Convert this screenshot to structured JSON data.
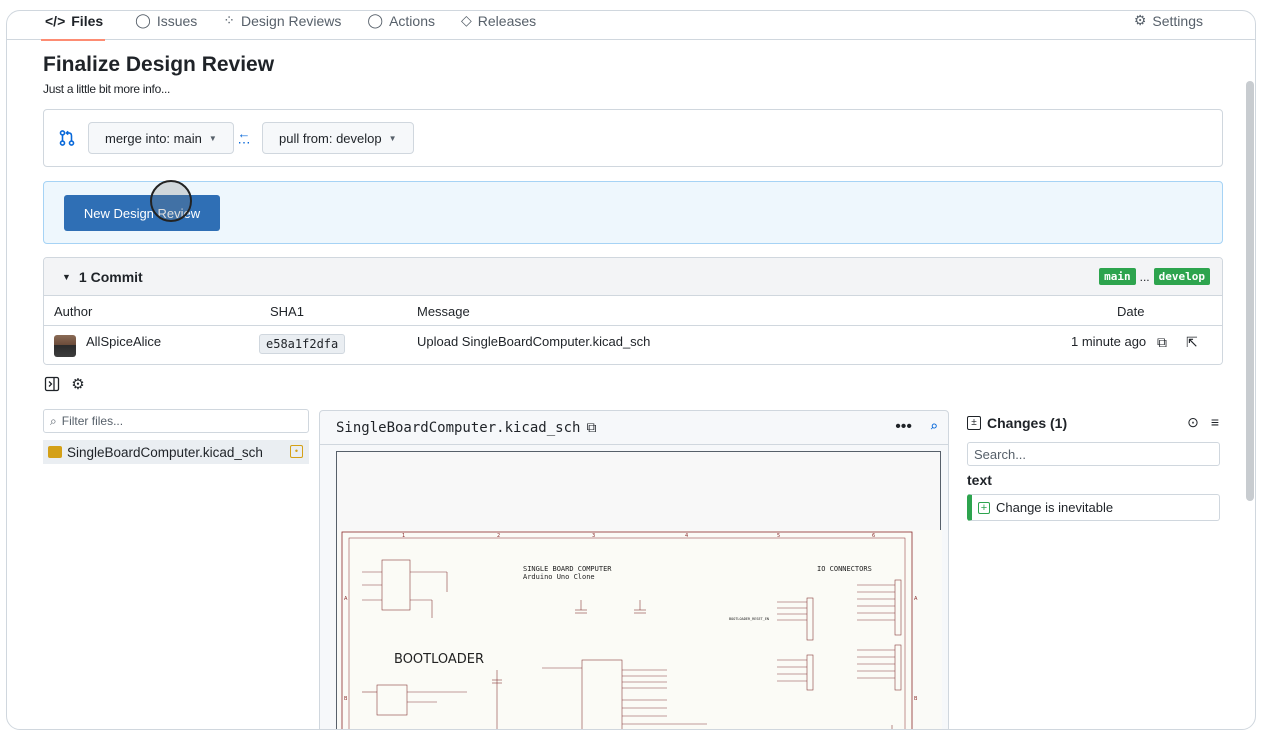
{
  "nav": {
    "tabs": [
      {
        "label": "Files",
        "icon": "code-icon"
      },
      {
        "label": "Issues",
        "icon": "issue-icon"
      },
      {
        "label": "Design Reviews",
        "icon": "design-review-icon"
      },
      {
        "label": "Actions",
        "icon": "actions-icon"
      },
      {
        "label": "Releases",
        "icon": "tag-icon"
      }
    ],
    "settings": "Settings"
  },
  "page": {
    "title": "Finalize Design Review",
    "subtitle": "Just a little bit more info..."
  },
  "branches": {
    "merge_into": "merge into: main",
    "pull_from": "pull from: develop"
  },
  "new_review_button": "New Design Review",
  "commits": {
    "header": "1 Commit",
    "base_tag": "main",
    "ellipsis": "...",
    "head_tag": "develop",
    "columns": {
      "author": "Author",
      "sha": "SHA1",
      "message": "Message",
      "date": "Date"
    },
    "rows": [
      {
        "author": "AllSpiceAlice",
        "sha": "e58a1f2dfa",
        "message": "Upload SingleBoardComputer.kicad_sch",
        "date": "1 minute ago"
      }
    ]
  },
  "files": {
    "filter_placeholder": "Filter files...",
    "items": [
      {
        "name": "SingleBoardComputer.kicad_sch"
      }
    ]
  },
  "preview": {
    "filename": "SingleBoardComputer.kicad_sch",
    "more": "•••"
  },
  "schematic": {
    "title": "SINGLE BOARD COMPUTER",
    "subtitle": "Arduino Uno Clone",
    "section_left": "BOOTLOADER",
    "section_right": "IO CONNECTORS",
    "col_numbers": [
      "1",
      "2",
      "3",
      "4",
      "5",
      "6"
    ],
    "row_letters": [
      "A",
      "B"
    ],
    "net_label": "BOOTLOADER_RESET_EN"
  },
  "changes": {
    "title": "Changes (1)",
    "search_placeholder": "Search...",
    "group": "text",
    "items": [
      {
        "label": "Change is inevitable"
      }
    ]
  },
  "colors": {
    "primary": "#2f6fb5",
    "tag_green": "#2da44e",
    "link_blue": "#0969da"
  }
}
